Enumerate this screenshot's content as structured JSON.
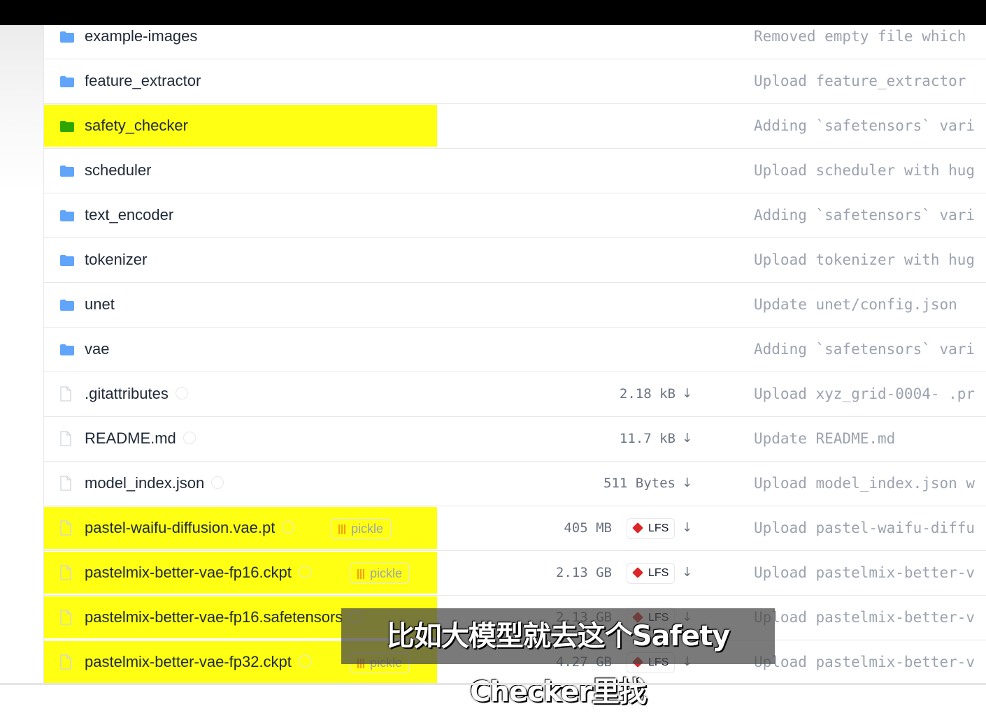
{
  "colors": {
    "folder": "#60a5fa",
    "folder_highlighted": "#2fa500",
    "highlight": "#ffff14",
    "lfs_red": "#dc2626",
    "pickle_orange": "#f59e0b"
  },
  "rows": [
    {
      "type": "folder",
      "name": "example-images",
      "commit": "Removed empty file which"
    },
    {
      "type": "folder",
      "name": "feature_extractor",
      "commit": "Upload feature_extractor"
    },
    {
      "type": "folder",
      "name": "safety_checker",
      "commit": "Adding `safetensors` vari",
      "highlighted": true
    },
    {
      "type": "folder",
      "name": "scheduler",
      "commit": "Upload scheduler with hug"
    },
    {
      "type": "folder",
      "name": "text_encoder",
      "commit": "Adding `safetensors` vari"
    },
    {
      "type": "folder",
      "name": "tokenizer",
      "commit": "Upload tokenizer with hug"
    },
    {
      "type": "folder",
      "name": "unet",
      "commit": "Update unet/config.json"
    },
    {
      "type": "folder",
      "name": "vae",
      "commit": "Adding `safetensors` vari"
    },
    {
      "type": "file",
      "name": ".gitattributes",
      "size": "2.18 kB",
      "commit": "Upload xyz_grid-0004- .pr"
    },
    {
      "type": "file",
      "name": "README.md",
      "size": "11.7 kB",
      "commit": "Update README.md"
    },
    {
      "type": "file",
      "name": "model_index.json",
      "size": "511 Bytes",
      "commit": "Upload model_index.json w"
    },
    {
      "type": "file",
      "name": "pastel-waifu-diffusion.vae.pt",
      "pickle": "pickle",
      "size": "405 MB",
      "lfs": "LFS",
      "commit": "Upload pastel-waifu-diffu",
      "highlighted": true
    },
    {
      "type": "file",
      "name": "pastelmix-better-vae-fp16.ckpt",
      "pickle": "pickle",
      "size": "2.13 GB",
      "lfs": "LFS",
      "commit": "Upload pastelmix-better-v",
      "highlighted": true
    },
    {
      "type": "file",
      "name": "pastelmix-better-vae-fp16.safetensors",
      "size": "2.13 GB",
      "lfs": "LFS",
      "commit": "Upload pastelmix-better-v",
      "highlighted": true
    },
    {
      "type": "file",
      "name": "pastelmix-better-vae-fp32.ckpt",
      "pickle": "pickle",
      "size": "4.27 GB",
      "lfs": "LFS",
      "commit": "Upload pastelmix-better-v",
      "highlighted": true
    }
  ],
  "subtitle": "比如大模型就去这个Safety Checker里找",
  "download_glyph": "↓"
}
